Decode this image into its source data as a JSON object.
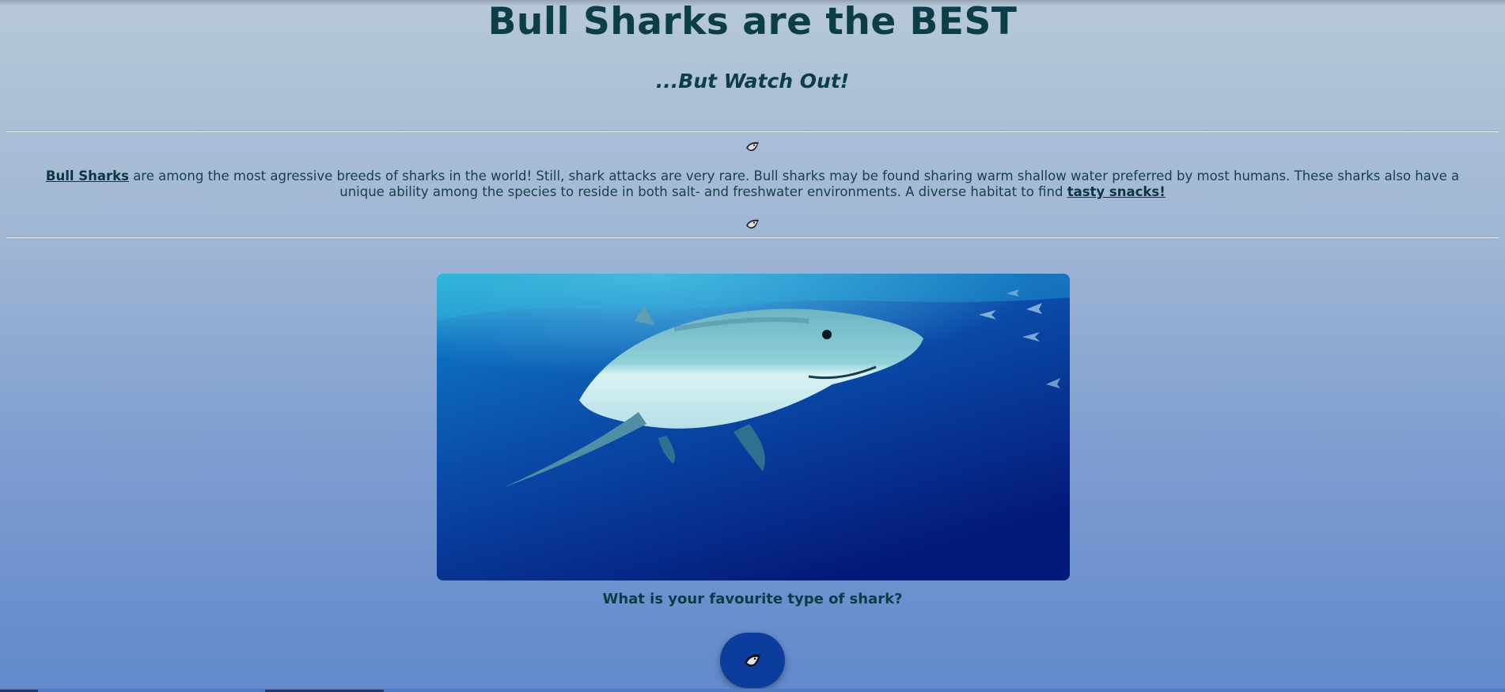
{
  "header": {
    "title": "Bull Sharks are the BEST",
    "subtitle": "...But Watch Out!"
  },
  "intro": {
    "link1_label": "Bull Sharks",
    "text_main": " are among the most agressive breeds of sharks in the world! Still, shark attacks are very rare. Bull sharks may be found sharing warm shallow water preferred by most humans. These sharks also have a unique ability among the species to reside in both salt- and freshwater environments. A diverse habitat to find ",
    "link2_label": "tasty snacks!"
  },
  "divider_icon": "shark-icon",
  "hero_image": {
    "subject": "shark-photo"
  },
  "question": "What is your favourite type of shark?",
  "fab": {
    "icon": "shark-icon"
  },
  "colors": {
    "text": "#0b3e47",
    "fab": "#0a3d9c",
    "bg_top": "#b6c8d8",
    "bg_bottom": "#6189cc"
  }
}
